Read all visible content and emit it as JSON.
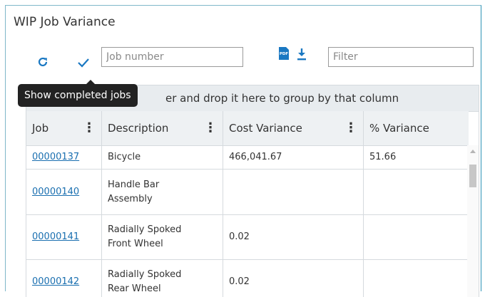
{
  "window": {
    "title": "WIP Job Variance"
  },
  "toolbar": {
    "refresh_icon": "refresh-icon",
    "check_icon": "checkmark-icon",
    "job_number_placeholder": "Job number",
    "pdf_icon": "pdf-icon",
    "download_icon": "download-icon",
    "filter_placeholder": "Filter"
  },
  "tooltip": {
    "text": "Show completed jobs"
  },
  "group_bar": {
    "text_visible": "er and drop it here to group by that column"
  },
  "grid": {
    "columns": [
      "Job",
      "Description",
      "Cost Variance",
      "% Variance"
    ],
    "rows": [
      {
        "job": "00000137",
        "description_lines": [
          "Bicycle"
        ],
        "cost_variance": "466,041.67",
        "pct_variance": "51.66"
      },
      {
        "job": "00000140",
        "description_lines": [
          "Handle Bar",
          "Assembly"
        ],
        "cost_variance": "",
        "pct_variance": ""
      },
      {
        "job": "00000141",
        "description_lines": [
          "Radially Spoked",
          "Front Wheel"
        ],
        "cost_variance": "0.02",
        "pct_variance": ""
      },
      {
        "job": "00000142",
        "description_lines": [
          "Radially Spoked",
          "Rear Wheel"
        ],
        "cost_variance": "0.02",
        "pct_variance": ""
      }
    ]
  },
  "colors": {
    "accent": "#1a78c2",
    "link": "#1a6fb0",
    "header_bg": "#eef1f3",
    "tooltip_bg": "#222222"
  }
}
